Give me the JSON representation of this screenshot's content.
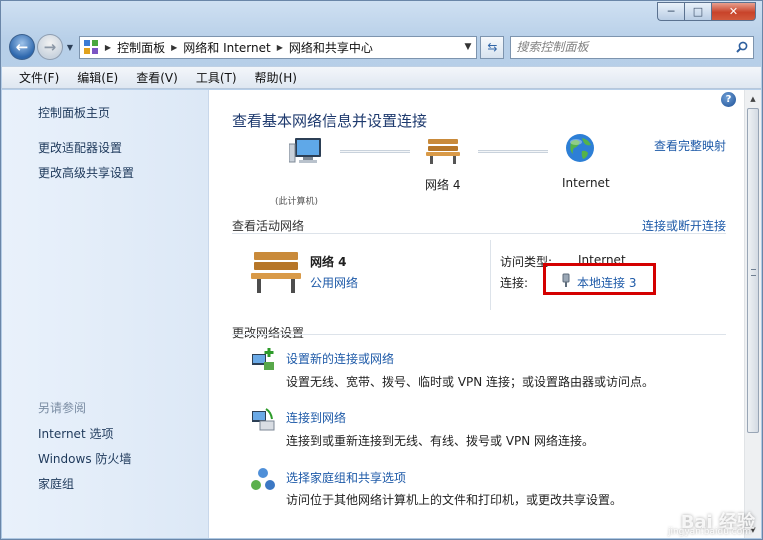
{
  "address": {
    "crumbs": [
      "控制面板",
      "网络和 Internet",
      "网络和共享中心"
    ]
  },
  "search": {
    "placeholder": "搜索控制面板"
  },
  "menu": [
    "文件(F)",
    "编辑(E)",
    "查看(V)",
    "工具(T)",
    "帮助(H)"
  ],
  "sidebar": {
    "links": [
      "控制面板主页",
      "更改适配器设置",
      "更改高级共享设置"
    ],
    "see_also_heading": "另请参阅",
    "see_also": [
      "Internet 选项",
      "Windows 防火墙",
      "家庭组"
    ]
  },
  "main": {
    "title": "查看基本网络信息并设置连接",
    "view_full_map": "查看完整映射",
    "map": {
      "network_label": "网络  4",
      "internet_label": "Internet",
      "computer_label": "(此计算机)"
    },
    "active_heading": "查看活动网络",
    "connect_disconnect": "连接或断开连接",
    "active_network": {
      "name": "网络  4",
      "type": "公用网络",
      "access_type_label": "访问类型:",
      "access_type_value": "Internet",
      "connection_label": "连接:",
      "connection_value": "本地连接 3"
    },
    "change_heading": "更改网络设置",
    "tasks": [
      {
        "title": "设置新的连接或网络",
        "desc": "设置无线、宽带、拨号、临时或 VPN 连接；或设置路由器或访问点。"
      },
      {
        "title": "连接到网络",
        "desc": "连接到或重新连接到无线、有线、拨号或 VPN 网络连接。"
      },
      {
        "title": "选择家庭组和共享选项",
        "desc": "访问位于其他网络计算机上的文件和打印机，或更改共享设置。"
      }
    ]
  },
  "watermark": {
    "brand": "Bai 经验",
    "site": "jingyan.baidu.com"
  },
  "colors": {
    "link": "#1e5aa8",
    "title": "#1e3a6e",
    "highlight": "#d40000"
  }
}
